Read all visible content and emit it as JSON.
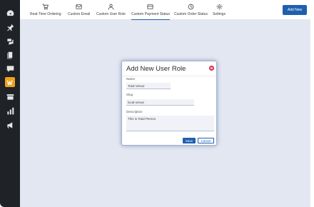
{
  "toolbar": {
    "tabs": [
      {
        "label": "Real-Time Ordering",
        "icon": "cart-icon"
      },
      {
        "label": "Custom Email",
        "icon": "email-icon"
      },
      {
        "label": "Custom User Role",
        "icon": "user-icon"
      },
      {
        "label": "Custom Payment Status",
        "icon": "payment-icon"
      },
      {
        "label": "Custom Order Status",
        "icon": "order-status-icon"
      },
      {
        "label": "Settings",
        "icon": "gear-icon"
      }
    ],
    "active_tab": "Custom Payment Status",
    "add_new_label": "Add New"
  },
  "sidebar": {
    "icons": [
      "dashboard-icon",
      "pin-icon",
      "media-icon",
      "pages-icon",
      "comments-icon",
      "woo-icon",
      "products-icon",
      "analytics-icon",
      "marketing-icon"
    ],
    "active": "woo-icon"
  },
  "modal": {
    "title": "Add New User Role",
    "name_label": "Name",
    "name_value": "Total Venue",
    "slug_label": "Slug",
    "slug_value": "local-venue",
    "description_label": "Description",
    "description_value": "This is Total Person",
    "save_label": "Save",
    "cancel_label": "Cancel"
  },
  "colors": {
    "accent": "#1f5fae",
    "sidebar_bg": "#1f2327",
    "active_menu": "#f0a21a",
    "close": "#d6213b",
    "content_bg": "#e3e7f1"
  }
}
